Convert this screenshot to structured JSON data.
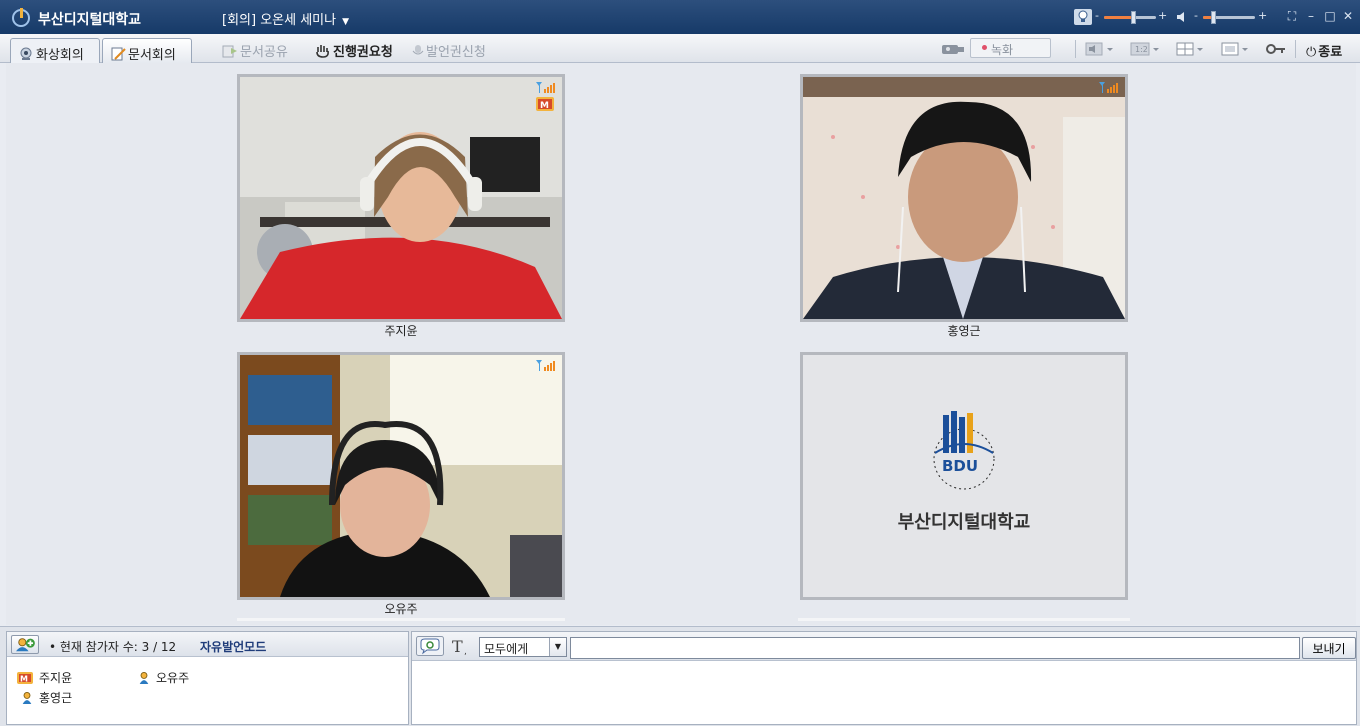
{
  "titlebar": {
    "app_title": "부산디지털대학교",
    "meeting_title": "[회의] 오온세 세미나",
    "controls": {
      "mic_level": 0.55,
      "speaker_level": 0.2
    }
  },
  "toolbar": {
    "tabs": [
      {
        "label": "화상회의",
        "active": true
      },
      {
        "label": "문서회의",
        "active": false
      }
    ],
    "doc_share": "문서공유",
    "request_control": "진행권요청",
    "request_speak": "발언권신청",
    "record": "녹화",
    "quit": "종료"
  },
  "videos": [
    {
      "name": "주지윤",
      "host": true
    },
    {
      "name": "홍영근",
      "host": false
    },
    {
      "name": "오유주",
      "host": false
    }
  ],
  "logo_tile": {
    "logo_text": "BDU",
    "school_name": "부산디지털대학교"
  },
  "participants": {
    "count_text": "• 현재 참가자 수: 3 / 12",
    "mode": "자유발언모드",
    "list": [
      {
        "name": "주지윤",
        "role": "host"
      },
      {
        "name": "오유주",
        "role": "member"
      },
      {
        "name": "홍영근",
        "role": "member"
      }
    ]
  },
  "chat": {
    "recipient": "모두에게",
    "input_value": "",
    "send_label": "보내기"
  },
  "colors": {
    "titlebar": "#1e4373",
    "accent": "#f08040",
    "host_badge": "#d64a2a"
  }
}
